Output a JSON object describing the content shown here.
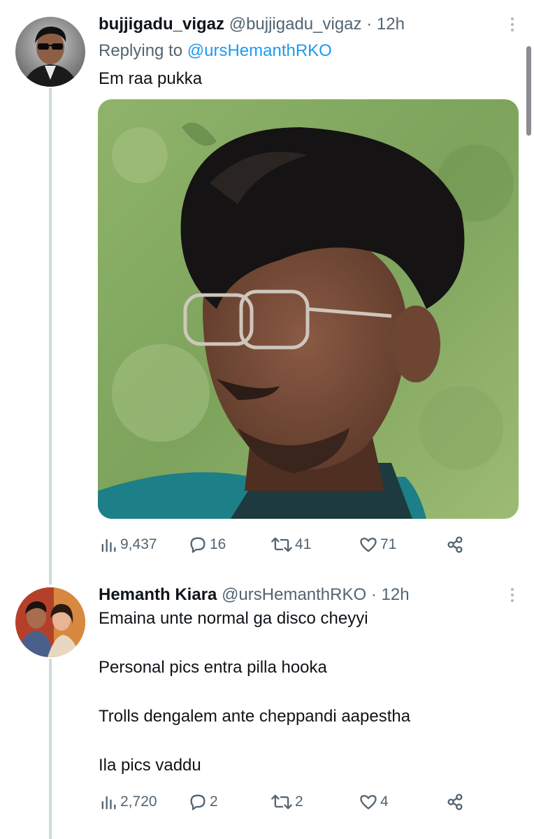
{
  "tweets": [
    {
      "display_name": "bujjigadu_vigaz",
      "handle": "@bujjigadu_vigaz",
      "separator": "·",
      "time": "12h",
      "replying_prefix": "Replying to",
      "replying_to": "@ursHemanthRKO",
      "text": "Em raa pukka",
      "stats": {
        "views": "9,437",
        "replies": "16",
        "retweets": "41",
        "likes": "71"
      }
    },
    {
      "display_name": "Hemanth Kiara",
      "handle": "@ursHemanthRKO",
      "separator": "·",
      "time": "12h",
      "lines": [
        "Emaina unte normal ga disco cheyyi",
        "Personal pics entra pilla hooka",
        "Trolls dengalem ante cheppandi aapestha",
        "Ila pics vaddu"
      ],
      "stats": {
        "views": "2,720",
        "replies": "2",
        "retweets": "2",
        "likes": "4"
      }
    }
  ],
  "colors": {
    "link": "#1d9bf0",
    "secondary_text": "#536471",
    "thread_line": "#cfd9de"
  },
  "icons": [
    "views-icon",
    "reply-icon",
    "retweet-icon",
    "like-icon",
    "share-icon",
    "more-icon"
  ]
}
